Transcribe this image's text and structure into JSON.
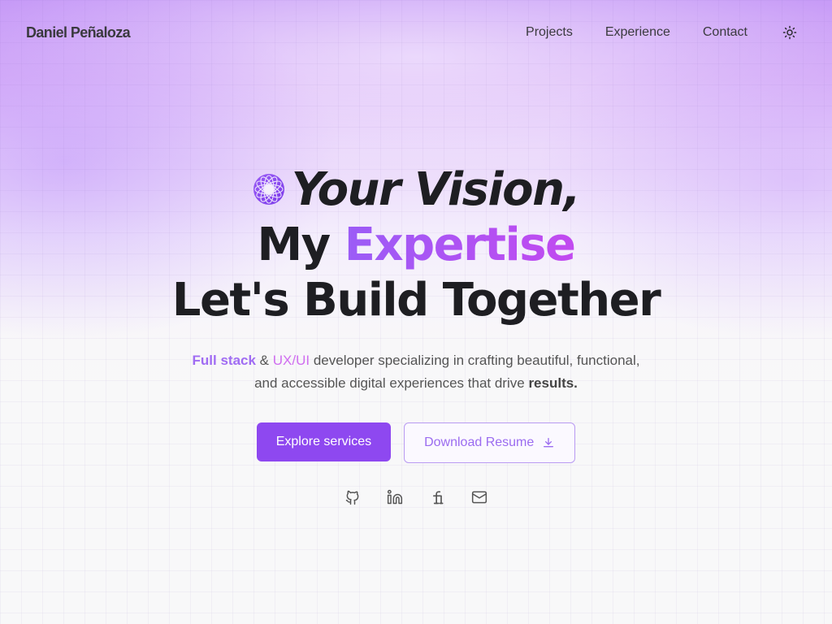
{
  "header": {
    "brand": "Daniel Peñaloza",
    "nav": [
      "Projects",
      "Experience",
      "Contact"
    ],
    "theme_toggle_icon": "sun-icon"
  },
  "hero": {
    "line1": "Your Vision,",
    "line2_prefix": "My",
    "line2_accent": "Expertise",
    "line3": "Let's Build Together",
    "subtitle": {
      "full_stack": "Full stack",
      "amp": "&",
      "uxui": "UX/UI",
      "part1": "developer specializing in crafting beautiful,",
      "part2": "functional, and accessible digital experiences that drive",
      "results": "results."
    },
    "primary_button": "Explore services",
    "secondary_button": "Download Resume"
  },
  "socials": [
    "github-icon",
    "linkedin-icon",
    "freelancer-icon",
    "mail-icon"
  ],
  "colors": {
    "accent": "#8e48f0",
    "accent_gradient_end": "#c24af0",
    "text": "#1e1e22"
  }
}
